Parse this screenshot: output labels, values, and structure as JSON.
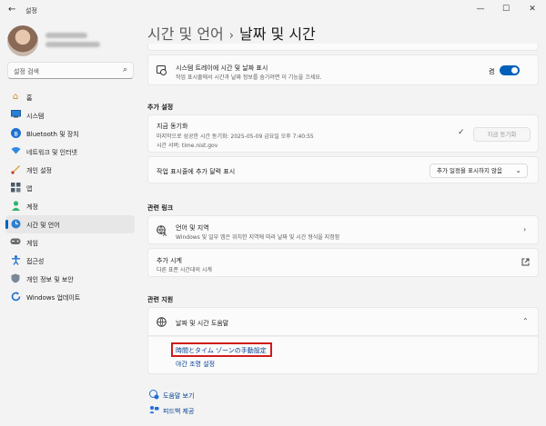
{
  "window": {
    "title": "설정",
    "back_glyph": "←",
    "minimize": "—",
    "maximize": "☐",
    "close": "✕"
  },
  "sidebar": {
    "search_placeholder": "설정 검색",
    "items": [
      {
        "label": "홈",
        "icon": "home-icon"
      },
      {
        "label": "시스템",
        "icon": "system-icon"
      },
      {
        "label": "Bluetooth 및 장치",
        "icon": "bluetooth-icon"
      },
      {
        "label": "네트워크 및 인터넷",
        "icon": "network-icon"
      },
      {
        "label": "개인 설정",
        "icon": "personalization-icon"
      },
      {
        "label": "앱",
        "icon": "apps-icon"
      },
      {
        "label": "계정",
        "icon": "account-icon"
      },
      {
        "label": "시간 및 언어",
        "icon": "time-language-icon",
        "active": true
      },
      {
        "label": "게임",
        "icon": "gaming-icon"
      },
      {
        "label": "접근성",
        "icon": "accessibility-icon"
      },
      {
        "label": "개인 정보 및 보안",
        "icon": "privacy-icon"
      },
      {
        "label": "Windows 업데이트",
        "icon": "update-icon"
      }
    ]
  },
  "breadcrumb": {
    "parent": "시간 및 언어",
    "separator": "›",
    "current": "날짜 및 시간"
  },
  "tray_row": {
    "title": "시스템 트레이에 시간 및 날짜 표시",
    "subtitle": "작업 표시줄에서 시간과 날짜 정보를 숨기려면 이 기능을 끄세요.",
    "toggle_label": "켬",
    "toggle_on": true
  },
  "additional_settings": {
    "header": "추가 설정",
    "sync": {
      "title": "지금 동기화",
      "line1": "마지막으로 성공한 시간 동기화: 2025-05-09 금요일 오후 7:40:55",
      "line2": "시간 서버: time.nist.gov",
      "check": "✓",
      "button": "지금 동기화"
    },
    "calendar": {
      "title": "작업 표시줄에 추가 달력 표시",
      "dropdown": "추가 일정을 표시하지 않음"
    }
  },
  "related_links": {
    "header": "관련 링크",
    "language": {
      "title": "언어 및 지역",
      "subtitle": "Windows 및 일부 앱은 위치한 지역에 따라 날짜 및 시간 형식을 지정함"
    },
    "clocks": {
      "title": "추가 시계",
      "subtitle": "다른 표준 시간대의 시계"
    }
  },
  "related_support": {
    "header": "관련 지원",
    "help": {
      "title": "날짜 및 시간 도움말"
    },
    "links": [
      "時間とタイム ゾーンの手動設定",
      "야간 조명 설정"
    ]
  },
  "footer": {
    "get_help": "도움말 보기",
    "feedback": "피드백 제공"
  },
  "colors": {
    "accent": "#005fb8",
    "highlight": "#d11a1a"
  }
}
